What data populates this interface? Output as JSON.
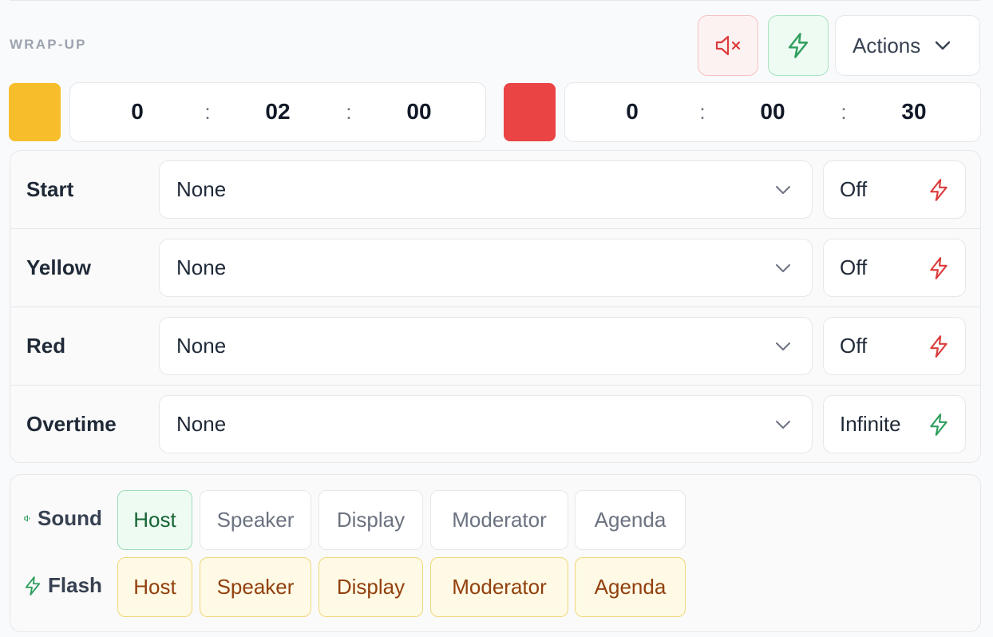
{
  "section": {
    "title": "WRAP-UP"
  },
  "header": {
    "mute_icon": "volume-x-icon",
    "flash_icon": "lightning-icon",
    "actions_label": "Actions"
  },
  "timers": {
    "yellow": {
      "hours": "0",
      "minutes": "02",
      "seconds": "00",
      "color": "#f5be2a"
    },
    "red": {
      "hours": "0",
      "minutes": "00",
      "seconds": "30",
      "color": "#ea4444"
    },
    "separator": ":"
  },
  "cues": [
    {
      "label": "Start",
      "sound": "None",
      "flash": "Off"
    },
    {
      "label": "Yellow",
      "sound": "None",
      "flash": "Off"
    },
    {
      "label": "Red",
      "sound": "None",
      "flash": "Off"
    },
    {
      "label": "Overtime",
      "sound": "None",
      "flash": "Infinite"
    }
  ],
  "outputs": {
    "sound": {
      "label": "Sound",
      "targets": [
        {
          "label": "Host",
          "active": true
        },
        {
          "label": "Speaker",
          "active": false
        },
        {
          "label": "Display",
          "active": false
        },
        {
          "label": "Moderator",
          "active": false
        },
        {
          "label": "Agenda",
          "active": false
        }
      ]
    },
    "flash": {
      "label": "Flash",
      "targets": [
        {
          "label": "Host",
          "active": true
        },
        {
          "label": "Speaker",
          "active": true
        },
        {
          "label": "Display",
          "active": true
        },
        {
          "label": "Moderator",
          "active": true
        },
        {
          "label": "Agenda",
          "active": true
        }
      ]
    }
  },
  "colors": {
    "danger": "#dc3c3c",
    "success": "#2f9e5e",
    "flash_text": "#92400e"
  }
}
